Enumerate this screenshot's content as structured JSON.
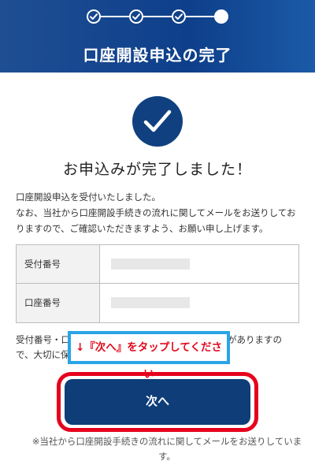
{
  "header": {
    "title": "口座開設申込の完了",
    "steps": [
      "done",
      "done",
      "done",
      "current"
    ]
  },
  "status": {
    "icon": "check-circle-icon",
    "heading": "お申込みが完了しました！"
  },
  "description": {
    "line1": "口座開設申込を受付いたしました。",
    "line2": "なお、当社から口座開設手続きの流れに関してメールをお送りしておりますので、ご確認いただきますよう、お願い申し上げます。"
  },
  "info_table": {
    "rows": [
      {
        "label": "受付番号"
      },
      {
        "label": "口座番号"
      }
    ]
  },
  "notice": {
    "line1_start": "受付番号・口",
    "line1_end": "がありますの",
    "line2_start": "で、大切に保"
  },
  "callout": {
    "text": "↓『次へ』をタップしてください"
  },
  "next_button": {
    "label": "次へ"
  },
  "footnote": {
    "text": "※当社から口座開設手続きの流れに関してメールをお送りしています。"
  },
  "colors": {
    "header_blue": "#0e3f8a",
    "button_navy": "#0e3d78",
    "highlight_red": "#e6001c",
    "callout_border": "#2aa4e6",
    "callout_text": "#e10a1e"
  }
}
